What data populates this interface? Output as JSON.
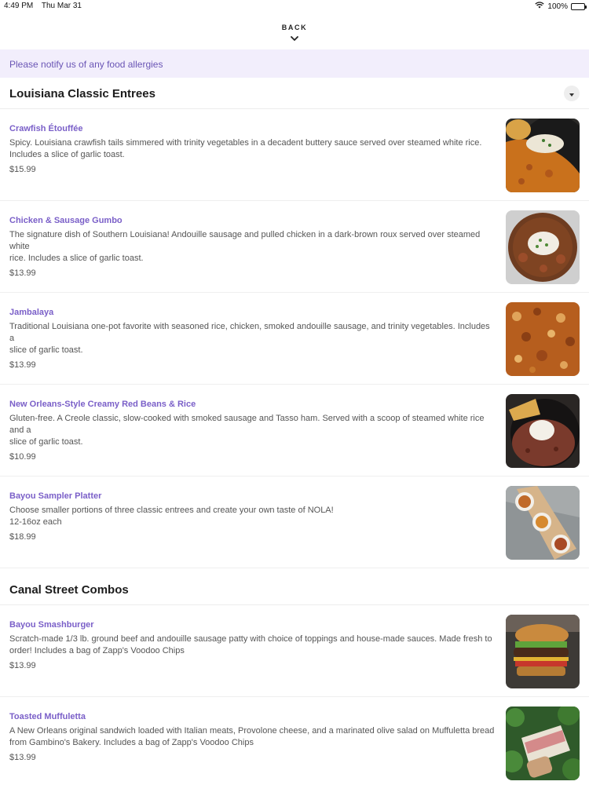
{
  "status_bar": {
    "time": "4:49 PM",
    "date": "Thu Mar 31",
    "battery": "100%"
  },
  "nav": {
    "back_label": "BACK"
  },
  "allergy_notice": "Please notify us of any food allergies",
  "sections": [
    {
      "title": "Louisiana Classic Entrees",
      "items": [
        {
          "name": "Crawfish Étouffée",
          "description": "Spicy. Louisiana crawfish tails simmered with trinity vegetables in a decadent buttery sauce served over steamed white rice.\nIncludes a slice of garlic toast.",
          "price": "$15.99"
        },
        {
          "name": "Chicken & Sausage Gumbo",
          "description": "The signature dish of Southern Louisiana! Andouille sausage and pulled chicken in a dark-brown roux served over steamed white\nrice. Includes a slice of garlic toast.",
          "price": "$13.99"
        },
        {
          "name": "Jambalaya",
          "description": "Traditional Louisiana one-pot favorite with seasoned rice, chicken, smoked andouille sausage, and trinity vegetables. Includes a\nslice of garlic toast.",
          "price": "$13.99"
        },
        {
          "name": "New Orleans-Style Creamy Red Beans & Rice",
          "description": "Gluten-free. A Creole classic, slow-cooked with smoked sausage and Tasso ham. Served with a scoop of steamed white rice and a\nslice of garlic toast.",
          "price": "$10.99"
        },
        {
          "name": "Bayou Sampler Platter",
          "description": "Choose smaller portions of three classic entrees and create your own taste of NOLA!\n12-16oz each",
          "price": "$18.99"
        }
      ]
    },
    {
      "title": "Canal Street Combos",
      "items": [
        {
          "name": "Bayou Smashburger",
          "description": "Scratch-made 1/3 lb. ground beef and andouille sausage patty with choice of toppings and house-made sauces. Made fresh to\norder! Includes a bag of Zapp's Voodoo Chips",
          "price": "$13.99"
        },
        {
          "name": "Toasted Muffuletta",
          "description": "A New Orleans original sandwich loaded with Italian meats, Provolone cheese, and a marinated olive salad on Muffuletta bread\nfrom Gambino's Bakery. Includes a bag of Zapp's Voodoo Chips",
          "price": "$13.99"
        }
      ]
    }
  ],
  "colors": {
    "accent": "#7a5fc8",
    "banner_bg": "#f2eefc",
    "banner_text": "#6a55b5"
  },
  "icons": {
    "back": "chevron-down-icon",
    "collapse": "caret-down-icon",
    "wifi": "wifi-icon",
    "battery": "battery-icon"
  }
}
